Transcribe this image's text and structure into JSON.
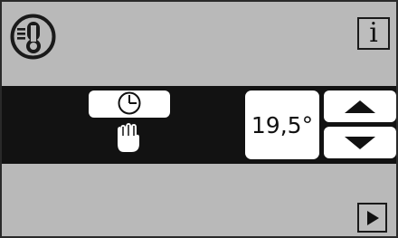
{
  "colors": {
    "background": "#b9b9b9",
    "band": "#121212",
    "button_fill": "#ffffff",
    "ink": "#111111"
  },
  "header": {
    "mode_icon": "thermometer-mode-icon",
    "info_label": "i"
  },
  "controls": {
    "timer_icon": "clock-icon",
    "manual_icon": "hand-icon",
    "setpoint_value": "19,5°",
    "increase_icon": "arrow-up-icon",
    "decrease_icon": "arrow-down-icon"
  },
  "footer": {
    "next_icon": "play-icon"
  }
}
